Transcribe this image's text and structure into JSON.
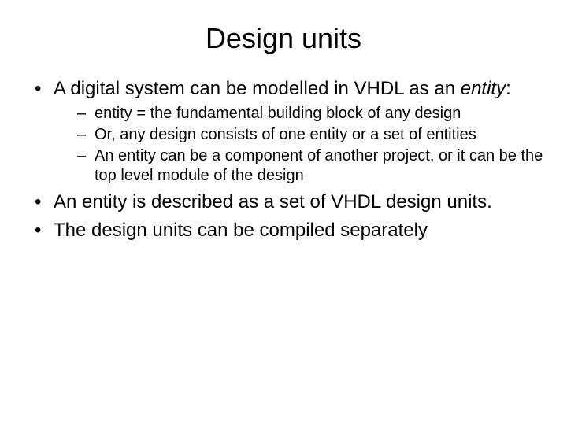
{
  "title": "Design units",
  "bullets": {
    "b1_part1": "A digital system can be modelled in VHDL as an ",
    "b1_part2_italic": "entity",
    "b1_part3": ":",
    "b1_sub1": "entity = the fundamental building block of any design",
    "b1_sub2": "Or, any design consists of one entity or a set of entities",
    "b1_sub3": "An entity can be a component of another project, or it can be the top level module of the design",
    "b2": "An entity is described as a set of VHDL design units.",
    "b3": "The design units can be compiled separately"
  }
}
